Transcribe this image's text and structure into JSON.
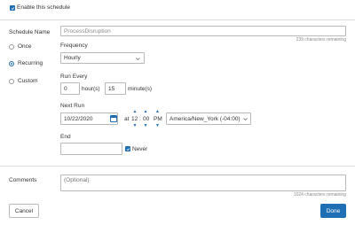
{
  "enable": {
    "label": "Enable this schedule",
    "checked": true
  },
  "schedule_name": {
    "label": "Schedule Name",
    "value": "ProcessDisruption",
    "remaining": "239 characters remaining"
  },
  "schedule_types": [
    {
      "label": "Once",
      "selected": false
    },
    {
      "label": "Recurring",
      "selected": true
    },
    {
      "label": "Custom",
      "selected": false
    }
  ],
  "frequency": {
    "label": "Frequency",
    "value": "Hourly"
  },
  "run_every": {
    "label": "Run Every",
    "hours_value": "0",
    "hours_unit": "hour(s)",
    "minutes_value": "15",
    "minutes_unit": "minute(s)"
  },
  "next_run": {
    "label": "Next Run",
    "date": "10/22/2020",
    "at": "at",
    "hour": "12",
    "minute": "00",
    "ampm": "PM",
    "timezone": "America/New_York (-04:00)"
  },
  "end": {
    "label": "End",
    "value": "",
    "never_label": "Never",
    "never_checked": true
  },
  "comments": {
    "label": "Comments",
    "placeholder": "(Optional)",
    "remaining": "1024 characters remaining"
  },
  "buttons": {
    "cancel": "Cancel",
    "done": "Done"
  },
  "colors": {
    "accent": "#1f6fb5",
    "separator": "#dcdcdc"
  },
  "icons": [
    "checkmark-icon",
    "calendar-icon",
    "chevron-up-icon",
    "chevron-down-icon"
  ]
}
